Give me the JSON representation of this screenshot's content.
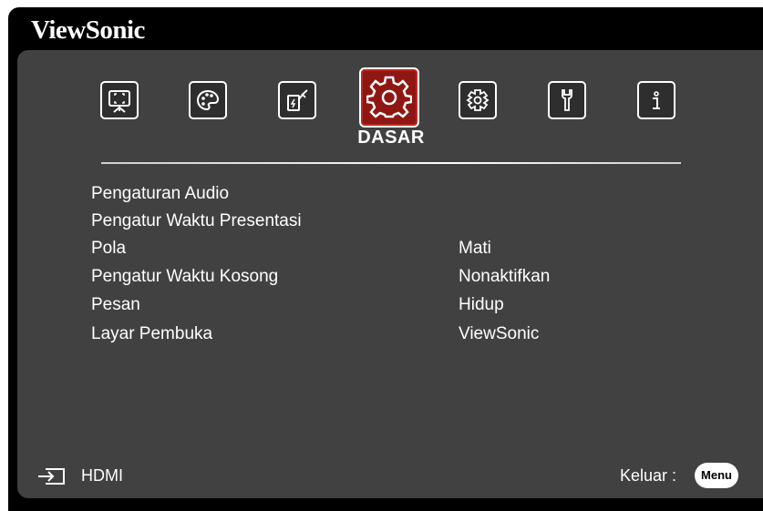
{
  "brand": "ViewSonic",
  "tabs": [
    {
      "icon": "display-icon"
    },
    {
      "icon": "palette-icon"
    },
    {
      "icon": "power-icon"
    },
    {
      "icon": "gear-icon",
      "label": "DASAR",
      "active": true
    },
    {
      "icon": "advanced-gear-icon"
    },
    {
      "icon": "wrench-icon"
    },
    {
      "icon": "info-icon"
    }
  ],
  "menu_items": [
    {
      "label": "Pengaturan Audio",
      "value": ""
    },
    {
      "label": "Pengatur Waktu Presentasi",
      "value": ""
    },
    {
      "label": "Pola",
      "value": "Mati"
    },
    {
      "label": "Pengatur Waktu Kosong",
      "value": "Nonaktifkan"
    },
    {
      "label": "Pesan",
      "value": "Hidup"
    },
    {
      "label": "Layar Pembuka",
      "value": "ViewSonic"
    }
  ],
  "footer": {
    "source": "HDMI",
    "exit_label": "Keluar :",
    "menu_button": "Menu"
  },
  "colors": {
    "panel": "#414141",
    "active_tab": "#8f1713",
    "background": "#000000"
  }
}
